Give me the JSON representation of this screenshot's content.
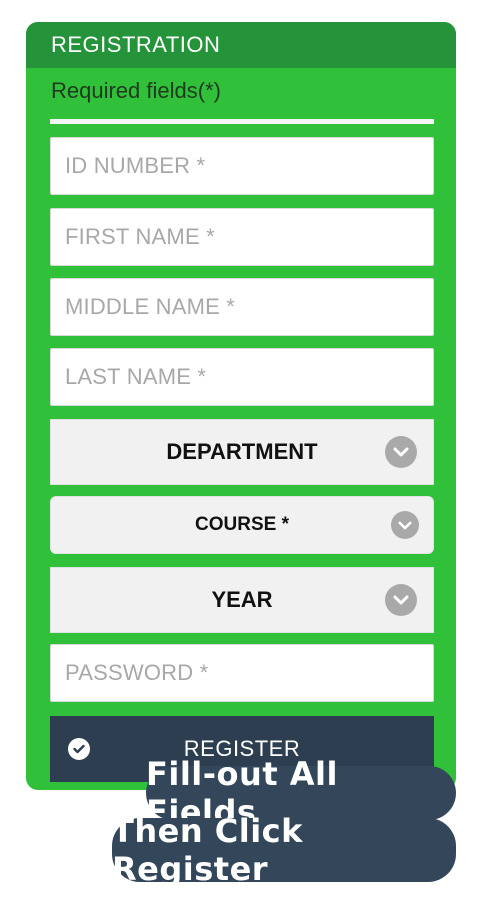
{
  "form": {
    "title": "REGISTRATION",
    "required_note": "Required fields(*)",
    "fields": {
      "id_number": "ID NUMBER *",
      "first_name": "FIRST NAME *",
      "middle_name": "MIDDLE NAME *",
      "last_name": "LAST NAME *",
      "password": "PASSWORD *"
    },
    "selects": {
      "department": "DEPARTMENT",
      "course": "COURSE *",
      "year": "YEAR"
    },
    "register_label": "REGISTER"
  },
  "callouts": {
    "line1": "Fill-out All Fields",
    "line2": "Then Click Register"
  },
  "colors": {
    "card_green": "#31c03a",
    "header_green": "#24933a",
    "register_navy": "#2c3e50",
    "callout_navy": "#34475a"
  },
  "icons": {
    "chevron": "chevron-down-icon",
    "check": "check-circle-icon"
  }
}
